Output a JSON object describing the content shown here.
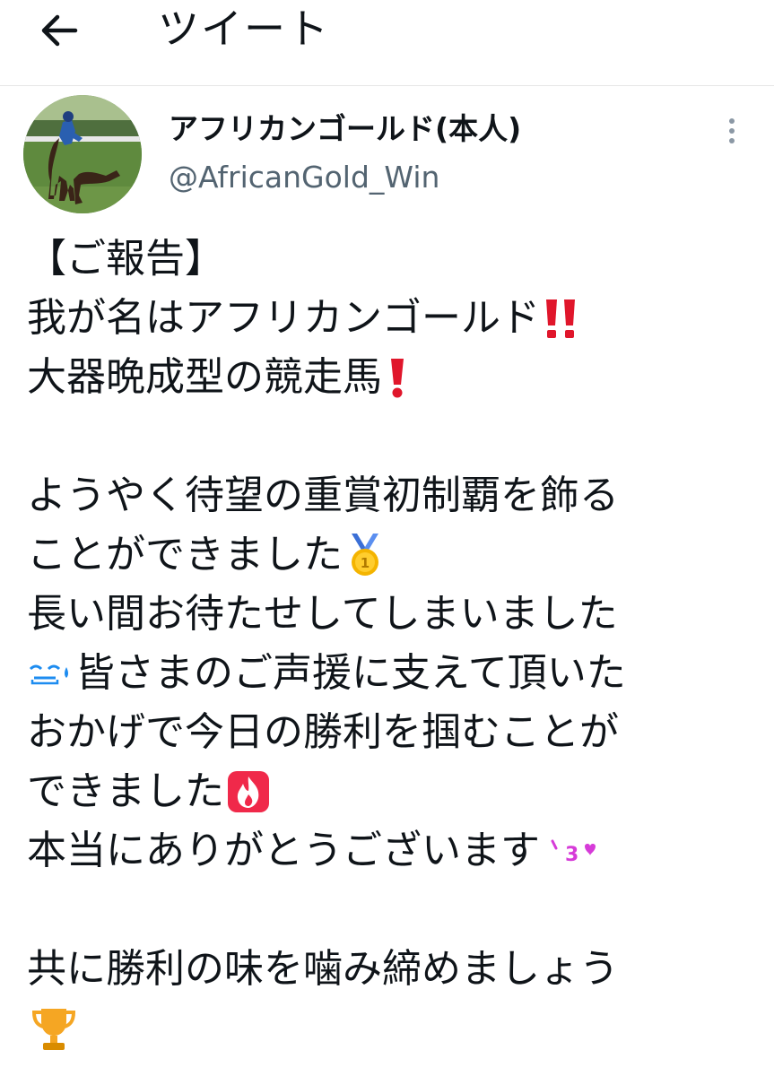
{
  "header": {
    "title": "ツイート",
    "back_icon": "arrow-left-icon"
  },
  "author": {
    "display_name": "アフリカンゴールド(本人)",
    "handle": "@AfricanGold_Win",
    "avatar": "racehorse-photo-avatar",
    "more_icon": "more-vertical-icon"
  },
  "tweet": {
    "lines": [
      {
        "text": "【ご報告】",
        "emoji": ""
      },
      {
        "text": "我が名はアフリカンゴールド",
        "emoji": "double-exclamation-icon"
      },
      {
        "text": "大器晩成型の競走馬",
        "emoji": "exclamation-icon"
      },
      {
        "text": "",
        "emoji": ""
      },
      {
        "text": "ようやく待望の重賞初制覇を飾る",
        "emoji": ""
      },
      {
        "text": "ことができました",
        "emoji": "gold-medal-icon"
      },
      {
        "text": "長い間お待たせしてしまいました",
        "emoji": ""
      },
      {
        "text": "皆さまのご声援に支えて頂いた",
        "emoji": "sweat-emoji-icon",
        "emoji_before": true
      },
      {
        "text": "おかげで今日の勝利を掴むことが",
        "emoji": ""
      },
      {
        "text": "できました",
        "emoji": "fire-icon"
      },
      {
        "text": "本当にありがとうございます",
        "emoji": "kissing-heart-icon"
      },
      {
        "text": "",
        "emoji": ""
      },
      {
        "text": "共に勝利の味を噛み締めましょう",
        "emoji": ""
      },
      {
        "text": "",
        "emoji": "trophy-icon"
      }
    ]
  },
  "colors": {
    "text": "#0f1419",
    "secondary": "#536471",
    "divider": "#e6e6e6",
    "accent_red": "#e0162b",
    "gold": "#f4b400",
    "fire": "#f0294a",
    "sweat": "#1d8cf0",
    "kiss": "#d63bd8"
  }
}
